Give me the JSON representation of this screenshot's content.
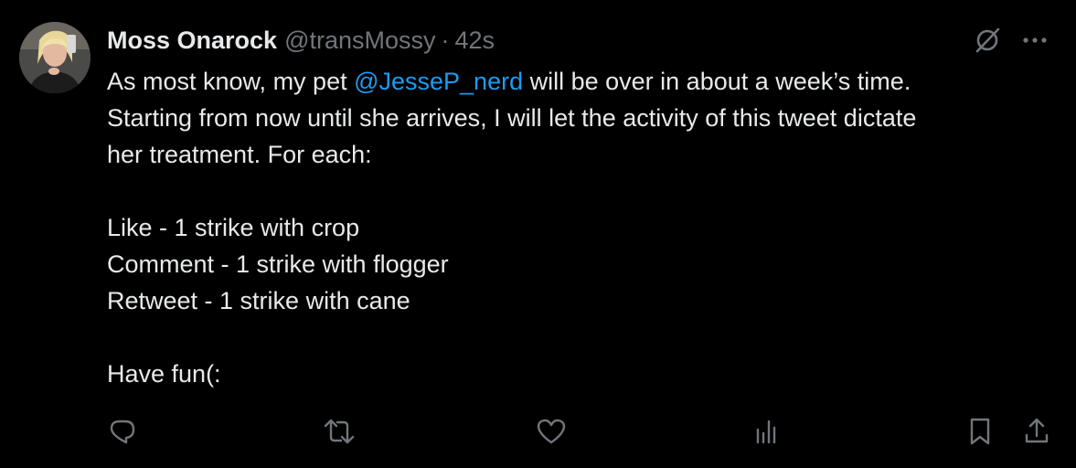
{
  "author": {
    "display_name": "Moss Onarock",
    "handle": "@transMossy",
    "separator": "·",
    "time": "42s",
    "avatar_icon": "profile-photo"
  },
  "tweet": {
    "line1_before": "As most know, my pet ",
    "mention": "@JesseP_nerd",
    "line1_after": " will be over in about a week’s time.",
    "line2": "Starting from now until she arrives, I will let the activity of this tweet dictate",
    "line3": "her treatment. For each:",
    "line4": "Like - 1 strike with crop",
    "line5": "Comment - 1 strike with flogger",
    "line6": "Retweet - 1 strike with cane",
    "line7": "Have fun(:"
  },
  "toolbar": {
    "icons": [
      "reply-icon",
      "retweet-icon",
      "like-icon",
      "views-icon",
      "bookmark-icon",
      "share-icon"
    ]
  },
  "header_icons": [
    "grok-icon",
    "more-icon"
  ],
  "colors": {
    "background": "#000000",
    "text": "#e7e9ea",
    "muted": "#71767b",
    "link": "#1d9bf0"
  }
}
